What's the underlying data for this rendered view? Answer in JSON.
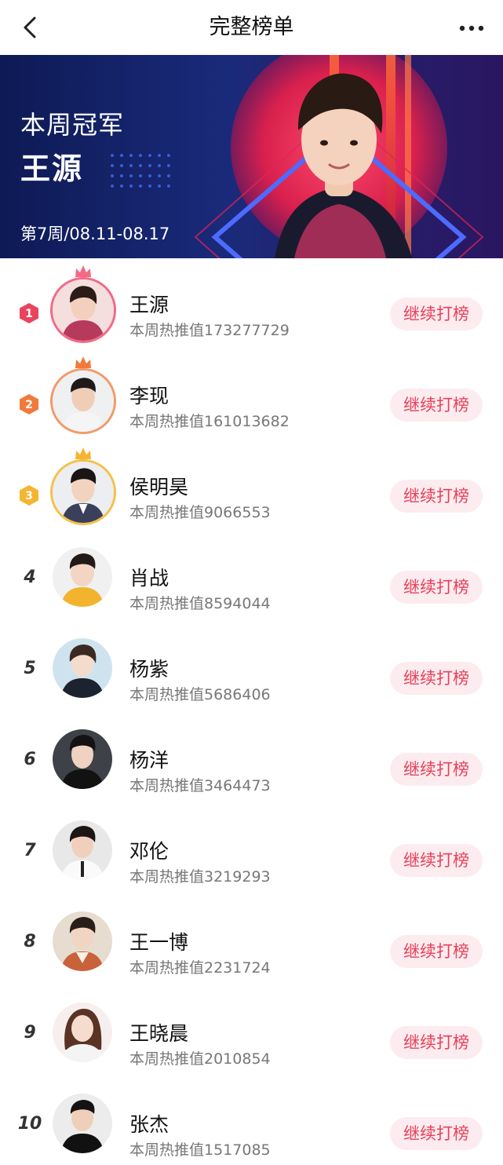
{
  "header": {
    "title": "完整榜单",
    "back_icon": "chevron-left-icon",
    "more_icon": "more-dots-icon"
  },
  "banner": {
    "champion_label": "本周冠军",
    "champion_name": "王源",
    "week": "第7周/08.11-08.17"
  },
  "colors": {
    "accent": "#e8405a",
    "button_bg": "#fdecef",
    "gold": "#f5b531",
    "silver_orange": "#f07a3c",
    "first_red": "#e9445e"
  },
  "ranking": [
    {
      "rank": "1",
      "name": "王源",
      "score": "本周热推值173277729",
      "button": "继续打榜"
    },
    {
      "rank": "2",
      "name": "李现",
      "score": "本周热推值161013682",
      "button": "继续打榜"
    },
    {
      "rank": "3",
      "name": "侯明昊",
      "score": "本周热推值9066553",
      "button": "继续打榜"
    },
    {
      "rank": "4",
      "name": "肖战",
      "score": "本周热推值8594044",
      "button": "继续打榜"
    },
    {
      "rank": "5",
      "name": "杨紫",
      "score": "本周热推值5686406",
      "button": "继续打榜"
    },
    {
      "rank": "6",
      "name": "杨洋",
      "score": "本周热推值3464473",
      "button": "继续打榜"
    },
    {
      "rank": "7",
      "name": "邓伦",
      "score": "本周热推值3219293",
      "button": "继续打榜"
    },
    {
      "rank": "8",
      "name": "王一博",
      "score": "本周热推值2231724",
      "button": "继续打榜"
    },
    {
      "rank": "9",
      "name": "王晓晨",
      "score": "本周热推值2010854",
      "button": "继续打榜"
    },
    {
      "rank": "10",
      "name": "张杰",
      "score": "本周热推值1517085",
      "button": "继续打榜"
    }
  ]
}
